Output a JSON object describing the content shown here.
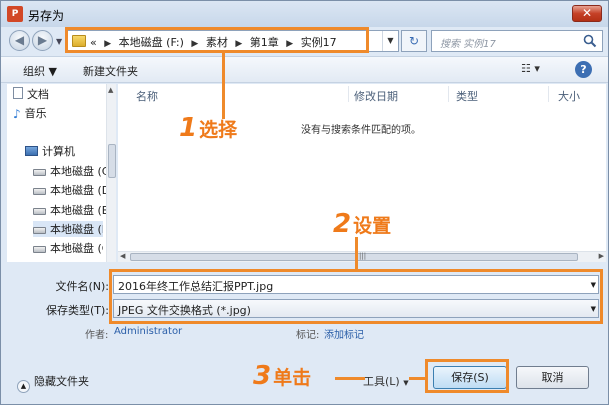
{
  "window": {
    "title": "另存为",
    "app_icon_text": "P",
    "close_glyph": "✕"
  },
  "address": {
    "prefix": "«",
    "crumbs": [
      "本地磁盘 (F:)",
      "素材",
      "第1章",
      "实例17"
    ],
    "search_placeholder": "搜索 实例17"
  },
  "toolbar": {
    "organize": "组织 ▼",
    "new_folder": "新建文件夹",
    "view": "☷ ▾",
    "help": "?"
  },
  "nav": {
    "items": [
      {
        "label": "文档",
        "icon": "document-icon"
      },
      {
        "label": "音乐",
        "icon": "music-icon"
      },
      {
        "label": "计算机",
        "icon": "computer-icon"
      },
      {
        "label": "本地磁盘 (C",
        "icon": "drive-icon"
      },
      {
        "label": "本地磁盘 (D",
        "icon": "drive-icon"
      },
      {
        "label": "本地磁盘 (E",
        "icon": "drive-icon"
      },
      {
        "label": "本地磁盘 (F",
        "icon": "drive-icon"
      },
      {
        "label": "本地磁盘 (G",
        "icon": "drive-icon"
      }
    ]
  },
  "filelist": {
    "columns": [
      "名称",
      "修改日期",
      "类型",
      "大小"
    ],
    "empty_message": "没有与搜索条件匹配的项。"
  },
  "form": {
    "filename_label": "文件名(N):",
    "filename_value": "2016年终工作总结汇报PPT.jpg",
    "type_label": "保存类型(T):",
    "type_value": "JPEG 文件交换格式 (*.jpg)",
    "author_label": "作者:",
    "author_value": "Administrator",
    "tag_label": "标记:",
    "tag_value": "添加标记"
  },
  "bottom": {
    "hide_folders": "隐藏文件夹",
    "tools": "工具(L)",
    "save": "保存(S)",
    "cancel": "取消"
  },
  "annotations": {
    "step1_num": "1",
    "step1_text": "选择",
    "step2_num": "2",
    "step2_text": "设置",
    "step3_num": "3",
    "step3_text": "单击"
  },
  "colors": {
    "annotation": "#ef8a2b"
  }
}
